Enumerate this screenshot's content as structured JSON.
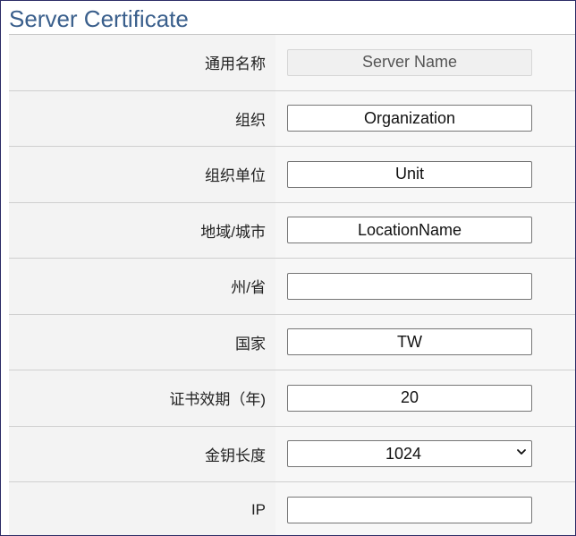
{
  "title": "Server Certificate",
  "rows": [
    {
      "label": "通用名称",
      "value": "Server Name",
      "kind": "disabled"
    },
    {
      "label": "组织",
      "value": "Organization",
      "kind": "text"
    },
    {
      "label": "组织单位",
      "value": "Unit",
      "kind": "text"
    },
    {
      "label": "地域/城市",
      "value": "LocationName",
      "kind": "text"
    },
    {
      "label": "州/省",
      "value": "",
      "kind": "text"
    },
    {
      "label": "国家",
      "value": "TW",
      "kind": "text"
    },
    {
      "label": "证书效期（年)",
      "value": "20",
      "kind": "text"
    },
    {
      "label": "金钥长度",
      "value": "1024",
      "kind": "select"
    },
    {
      "label": "IP",
      "value": "",
      "kind": "text"
    }
  ],
  "icons": {
    "select_arrow": "chevron-down-icon"
  },
  "colors": {
    "title": "#3a5f8c",
    "frame_border": "#2c2c66",
    "row_bg": "#f3f3f3"
  }
}
